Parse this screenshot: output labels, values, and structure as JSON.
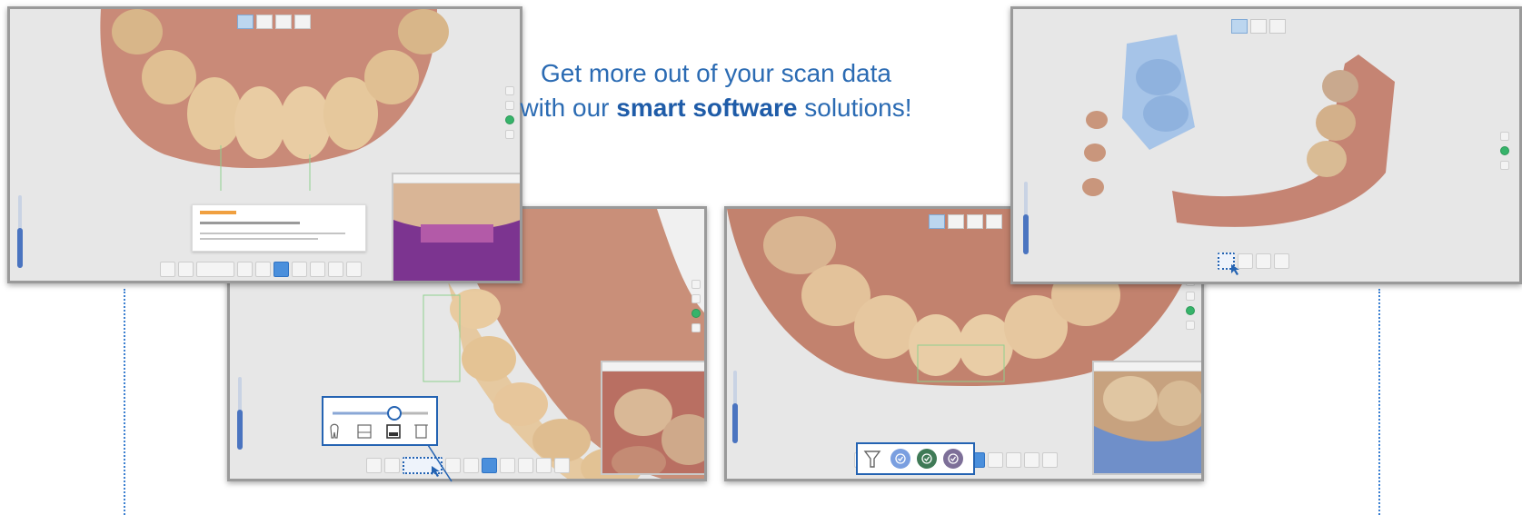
{
  "headline": {
    "line1": "Get more out of your scan data",
    "line2_prefix": "with our ",
    "line2_bold": "smart software",
    "line2_suffix": " solutions!"
  },
  "colors": {
    "accent_blue": "#2b6bb3",
    "callout_border": "#2463b2",
    "dotted_line": "#3b7fd0",
    "status_green": "#36b36a",
    "filter_blue": "#7a9fe0",
    "filter_green": "#3f7a56",
    "filter_purple": "#7d6f98"
  },
  "icons": {
    "brightness_slider": [
      "tooth-icon",
      "scanner-icon",
      "scanner-active-icon",
      "trash-icon"
    ],
    "filter": [
      "funnel-icon",
      "check-circle-blue-icon",
      "check-circle-green-icon",
      "check-circle-purple-icon"
    ]
  },
  "screenshots": [
    {
      "name": "top-left",
      "view": "lower-arch-frontal",
      "has_inset": true,
      "has_notification": true
    },
    {
      "name": "bottom-left",
      "view": "arch-side",
      "has_inset": true,
      "callout": "brightness-slider"
    },
    {
      "name": "bottom-right",
      "view": "upper-arch-occlusal",
      "has_inset": true,
      "callout": "filter-buttons"
    },
    {
      "name": "top-right",
      "view": "lower-arch-with-die",
      "has_inset": false
    }
  ]
}
